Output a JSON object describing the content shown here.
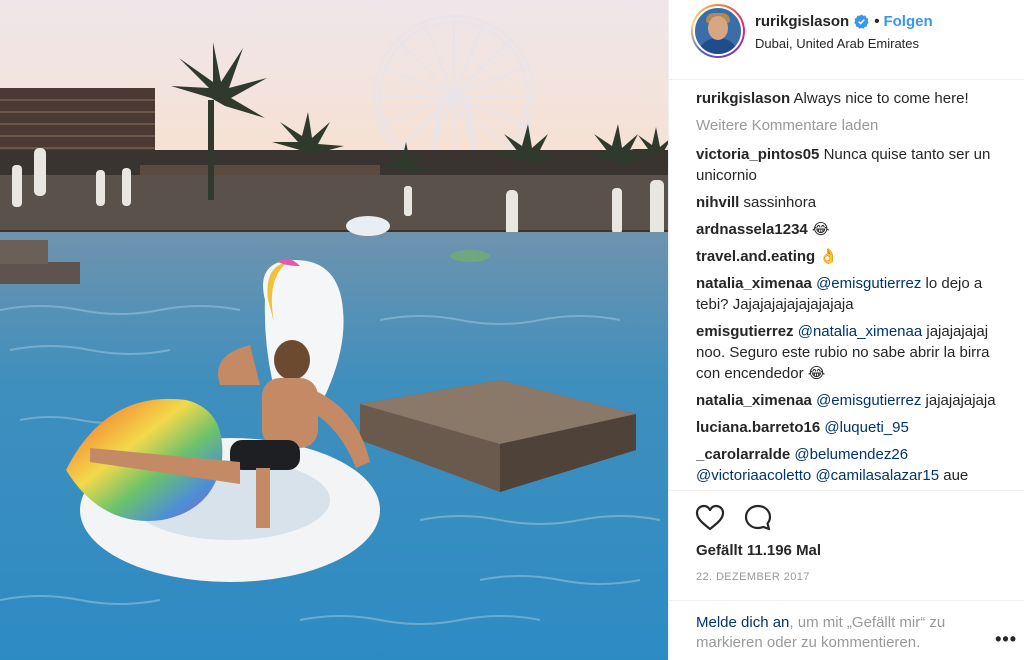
{
  "header": {
    "username": "rurikgislason",
    "separator": "•",
    "follow_label": "Folgen",
    "location": "Dubai, United Arab Emirates"
  },
  "caption": {
    "username": "rurikgislason",
    "text": "Always nice to come here!"
  },
  "load_more_label": "Weitere Kommentare laden",
  "comments": [
    {
      "user": "victoria_pintos05",
      "text": "Nunca quise tanto ser un unicornio"
    },
    {
      "user": "nihvill",
      "text": "sassinhora"
    },
    {
      "user": "ardnassela1234",
      "text": "😂"
    },
    {
      "user": "travel.and.eating",
      "text": "👌"
    },
    {
      "user": "natalia_ximenaa",
      "mention": "@emisgutierrez",
      "text": "lo dejo a tebi? Jajajajajajajajajaja"
    },
    {
      "user": "emisgutierrez",
      "mention": "@natalia_ximenaa",
      "text": "jajajajajaj noo. Seguro este rubio no sabe abrir la birra con encendedor 😂"
    },
    {
      "user": "natalia_ximenaa",
      "mention": "@emisgutierrez",
      "text": "jajajajajaja"
    },
    {
      "user": "luciana.barreto16",
      "mention": "@luqueti_95",
      "text": ""
    },
    {
      "user": "_carolarralde",
      "mention": "@belumendez26",
      "mention2": "@victoriaacoletto",
      "mention3": "@camilasalazar15",
      "text": "aue"
    }
  ],
  "likes": "Gefällt 11.196 Mal",
  "date": "22. DEZEMBER 2017",
  "login": {
    "link": "Melde dich an",
    "text": ", um mit „Gefällt mir“ zu markieren oder zu kommentieren."
  },
  "more_label": "•••",
  "icons": {
    "like": "heart-icon",
    "comment": "comment-bubble-icon",
    "verified": "verified-badge-icon"
  },
  "colors": {
    "accent": "#3897f0",
    "link": "#003569",
    "muted": "#999999"
  }
}
